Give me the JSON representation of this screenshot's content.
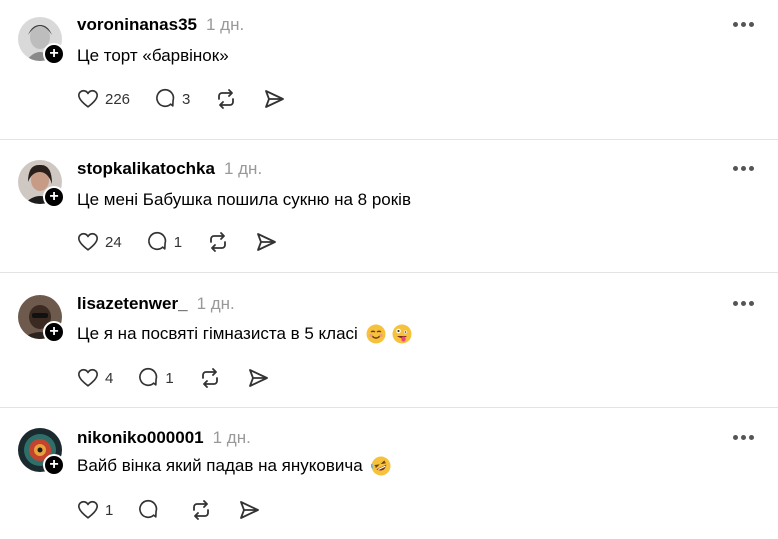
{
  "posts": [
    {
      "username": "voroninanas35",
      "time": "1 дн.",
      "text": "Це торт «барвінок»",
      "likes": "226",
      "replies": "3",
      "emojis": []
    },
    {
      "username": "stopkalikatochka",
      "time": "1 дн.",
      "text": "Це мені Бабушка пошила сукню на 8 років",
      "likes": "24",
      "replies": "1",
      "emojis": []
    },
    {
      "username": "lisazetenwer_",
      "time": "1 дн.",
      "text": "Це я на посвяті гімназиста в 5 класі",
      "likes": "4",
      "replies": "1",
      "emojis": [
        "smiling-blush-emoji",
        "zany-face-emoji"
      ]
    },
    {
      "username": "nikoniko000001",
      "time": "1 дн.",
      "text": "Вайб вінка який падав на януковича",
      "likes": "1",
      "replies": "",
      "emojis": [
        "rolling-laughing-emoji"
      ]
    }
  ],
  "colors": {
    "text": "#000000",
    "muted": "#999999",
    "divider": "#e3e3e3",
    "badge": "#000000",
    "emoji": "#f7c23b"
  },
  "icons": [
    "heart-icon",
    "comment-icon",
    "repost-icon",
    "share-icon",
    "more-icon",
    "plus-icon"
  ]
}
